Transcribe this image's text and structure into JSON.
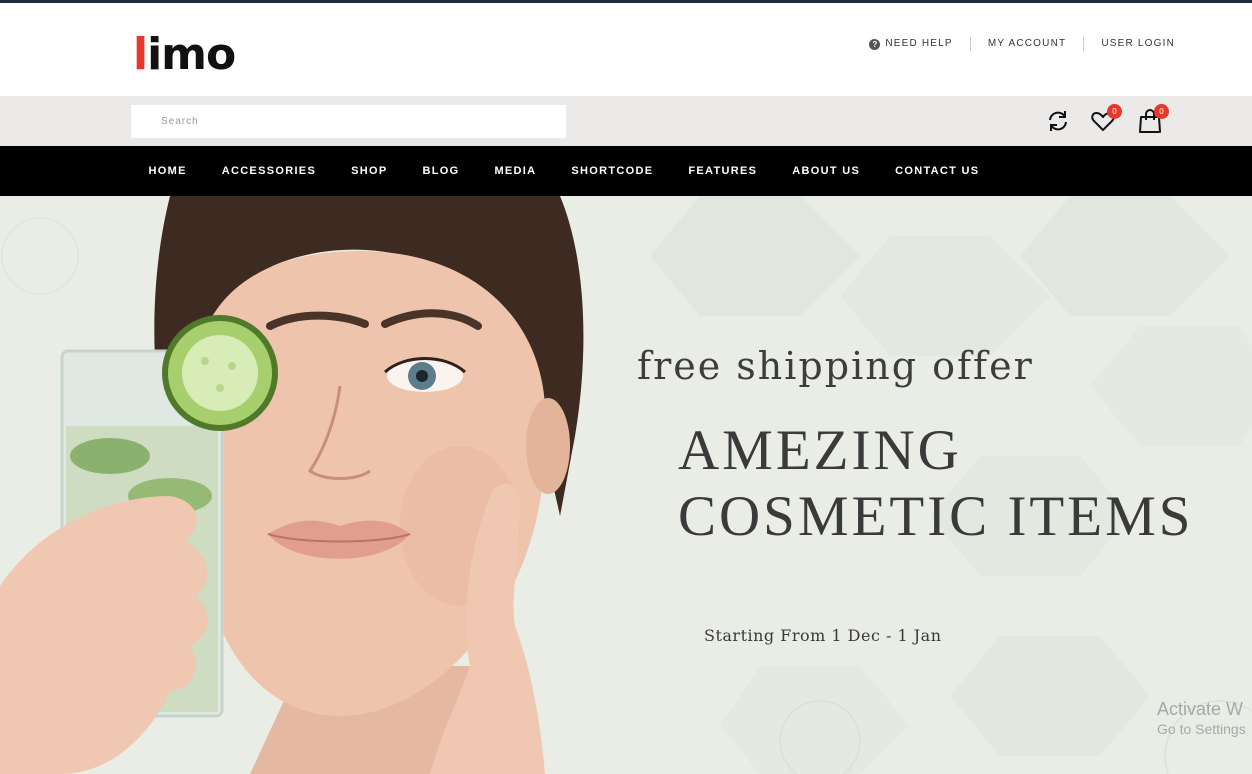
{
  "header": {
    "logo_first_letter": "l",
    "logo_rest": "imo",
    "links": [
      {
        "label": "NEED HELP",
        "icon": "question-circle-icon"
      },
      {
        "label": "MY ACCOUNT"
      },
      {
        "label": "USER LOGIN"
      }
    ]
  },
  "search": {
    "placeholder": "Search",
    "value": ""
  },
  "toolbar": {
    "compare_icon": "refresh-icon",
    "wishlist_icon": "heart-icon",
    "wishlist_count": "0",
    "cart_icon": "shopping-bag-icon",
    "cart_count": "0"
  },
  "nav": {
    "items": [
      "HOME",
      "ACCESSORIES",
      "SHOP",
      "BLOG",
      "MEDIA",
      "SHORTCODE",
      "FEATURES",
      "ABOUT US",
      "CONTACT US"
    ]
  },
  "hero": {
    "offer": "free shipping offer",
    "headline_line1": "AMEZING",
    "headline_line2": "COSMETIC ITEMS",
    "dates": "Starting From 1 Dec - 1 Jan"
  },
  "watermark": {
    "line1": "Activate W",
    "line2": "Go to Settings"
  },
  "colors": {
    "accent": "#e8382b",
    "nav_bg": "#000000",
    "search_band": "#ebeae8",
    "hero_bg": "#e9ede6"
  }
}
